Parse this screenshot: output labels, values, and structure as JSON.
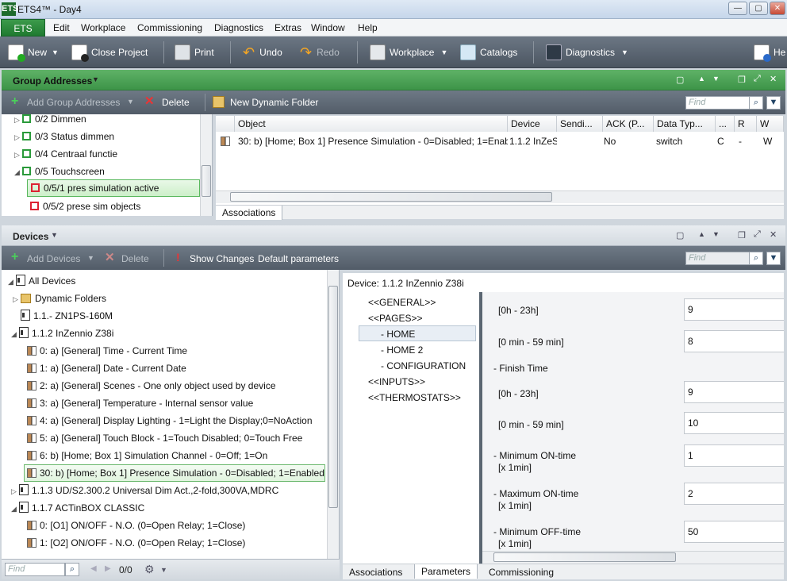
{
  "window": {
    "title": "ETS4™ - Day4",
    "logo": "ETS",
    "minimize": "—",
    "restore": "▢",
    "close": "✕"
  },
  "menu": {
    "ets": "ETS",
    "items": [
      "Edit",
      "Workplace",
      "Commissioning",
      "Diagnostics",
      "Extras",
      "Window",
      "Help"
    ]
  },
  "toolbar": {
    "new": "New",
    "close_project": "Close Project",
    "print": "Print",
    "undo": "Undo",
    "redo": "Redo",
    "workplace": "Workplace",
    "catalogs": "Catalogs",
    "diagnostics": "Diagnostics",
    "help": "He"
  },
  "group_panel": {
    "title": "Group Addresses",
    "add": "Add Group Addresses",
    "delete": "Delete",
    "new_folder": "New Dynamic Folder",
    "find_placeholder": "Find",
    "tree": [
      {
        "label": "0/2 Dimmen",
        "arrow": "▷",
        "color": "green"
      },
      {
        "label": "0/3 Status dimmen",
        "arrow": "▷",
        "color": "green"
      },
      {
        "label": "0/4 Centraal functie",
        "arrow": "▷",
        "color": "green"
      },
      {
        "label": "0/5 Touchscreen",
        "arrow": "◢",
        "color": "green"
      },
      {
        "label": "0/5/1 pres simulation active",
        "arrow": "",
        "color": "red"
      },
      {
        "label": "0/5/2 prese sim objects",
        "arrow": "",
        "color": "red"
      }
    ],
    "columns": [
      "Object",
      "Device",
      "Sendi...",
      "ACK (P...",
      "Data Typ...",
      "...",
      "R",
      "W"
    ],
    "row": {
      "object": "30: b)  [Home; Box 1] Presence Simulation - 0=Disabled; 1=Enab",
      "device": "1.1.2  InZeS",
      "ack": "No",
      "dtype": "switch",
      "c": "C",
      "r": "-",
      "w": "W"
    },
    "tab": "Associations"
  },
  "devices_panel": {
    "title": "Devices",
    "add": "Add Devices",
    "delete": "Delete",
    "show_changes": "Show Changes",
    "default_params": "Default parameters",
    "find_placeholder": "Find",
    "tree": [
      {
        "label": "All Devices",
        "arrow": "◢",
        "type": "root",
        "indent": 0
      },
      {
        "label": "Dynamic Folders",
        "arrow": "▷",
        "type": "folder",
        "indent": 1
      },
      {
        "label": "1.1.-  ZN1PS-160M",
        "arrow": "",
        "type": "dev",
        "indent": 1
      },
      {
        "label": "1.1.2  InZennio Z38i",
        "arrow": "◢",
        "type": "dev",
        "indent": 1
      },
      {
        "label": "0: a)  [General] Time - Current Time",
        "arrow": "",
        "type": "obj",
        "indent": 2
      },
      {
        "label": "1: a)  [General] Date - Current Date",
        "arrow": "",
        "type": "obj",
        "indent": 2
      },
      {
        "label": "2: a)  [General] Scenes - One only object used by device",
        "arrow": "",
        "type": "obj",
        "indent": 2
      },
      {
        "label": "3: a)  [General] Temperature - Internal sensor value",
        "arrow": "",
        "type": "obj",
        "indent": 2
      },
      {
        "label": "4: a)  [General] Display Lighting - 1=Light the Display;0=NoAction",
        "arrow": "",
        "type": "obj",
        "indent": 2
      },
      {
        "label": "5: a)  [General] Touch Block - 1=Touch Disabled; 0=Touch Free",
        "arrow": "",
        "type": "obj",
        "indent": 2
      },
      {
        "label": "6: b)  [Home; Box 1] Simulation Channel - 0=Off; 1=On",
        "arrow": "",
        "type": "obj",
        "indent": 2
      },
      {
        "label": "30: b)  [Home; Box 1] Presence Simulation - 0=Disabled; 1=Enabled",
        "arrow": "",
        "type": "obj",
        "indent": 2
      },
      {
        "label": "1.1.3  UD/S2.300.2 Universal Dim Act.,2-fold,300VA,MDRC",
        "arrow": "▷",
        "type": "dev",
        "indent": 1
      },
      {
        "label": "1.1.7  ACTinBOX CLASSIC",
        "arrow": "◢",
        "type": "dev",
        "indent": 1
      },
      {
        "label": "0: [O1] ON/OFF - N.O. (0=Open Relay; 1=Close)",
        "arrow": "",
        "type": "obj",
        "indent": 2
      },
      {
        "label": "1: [O2] ON/OFF - N.O. (0=Open Relay; 1=Close)",
        "arrow": "",
        "type": "obj",
        "indent": 2
      }
    ],
    "bottom_find": "Find",
    "counter": "0/0",
    "device_header": "Device: 1.1.2  InZennio Z38i",
    "nav": [
      "<<GENERAL>>",
      "<<PAGES>>",
      "- HOME",
      "- HOME 2",
      "- CONFIGURATION",
      "<<INPUTS>>",
      "<<THERMOSTATS>>"
    ],
    "params": [
      {
        "label": "[0h - 23h]",
        "value": "9"
      },
      {
        "label": "[0 min - 59 min]",
        "value": "8"
      },
      {
        "label": "- Finish Time",
        "value": ""
      },
      {
        "label": "[0h - 23h]",
        "value": "9"
      },
      {
        "label": "[0 min - 59 min]",
        "value": "10"
      },
      {
        "label": "- Minimum ON-time",
        "sub": "[x 1min]",
        "value": "1"
      },
      {
        "label": "- Maximum ON-time",
        "sub": "[x 1min]",
        "value": "2"
      },
      {
        "label": "- Minimum OFF-time",
        "sub": "[x 1min]",
        "value": "50"
      }
    ],
    "tabs": [
      "Associations",
      "Parameters",
      "Commissioning"
    ]
  },
  "colors": {
    "green": "#3d9448",
    "toolbar": "#5a6470"
  }
}
